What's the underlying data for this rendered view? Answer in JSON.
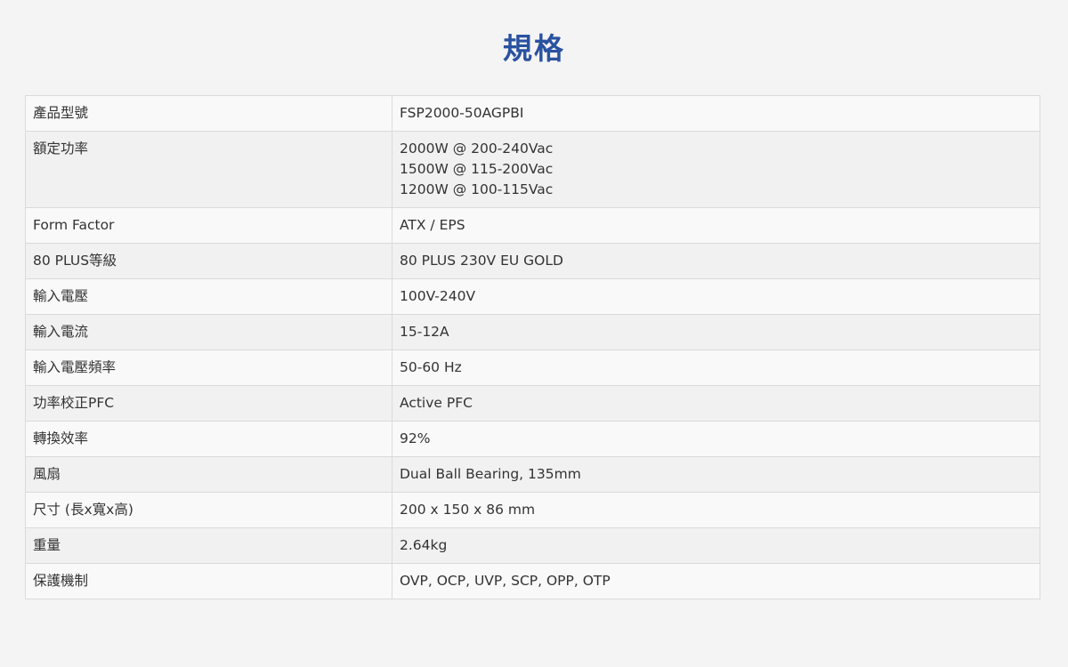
{
  "page": {
    "title": "規格"
  },
  "specs": {
    "rows": [
      {
        "label": "產品型號",
        "values": [
          "FSP2000-50AGPBI"
        ]
      },
      {
        "label": "額定功率",
        "values": [
          "2000W @ 200-240Vac",
          "1500W @ 115-200Vac",
          "1200W @ 100-115Vac"
        ]
      },
      {
        "label": "Form Factor",
        "values": [
          "ATX / EPS"
        ]
      },
      {
        "label": "80 PLUS等級",
        "values": [
          "80 PLUS 230V EU GOLD"
        ]
      },
      {
        "label": "輸入電壓",
        "values": [
          "100V-240V"
        ]
      },
      {
        "label": "輸入電流",
        "values": [
          "15-12A"
        ]
      },
      {
        "label": "輸入電壓頻率",
        "values": [
          "50-60 Hz"
        ]
      },
      {
        "label": "功率校正PFC",
        "values": [
          "Active PFC"
        ]
      },
      {
        "label": "轉換效率",
        "values": [
          "92%"
        ]
      },
      {
        "label": "風扇",
        "values": [
          "Dual Ball Bearing, 135mm"
        ]
      },
      {
        "label": "尺寸 (長x寬x高)",
        "values": [
          "200 x 150 x 86 mm"
        ]
      },
      {
        "label": "重量",
        "values": [
          "2.64kg"
        ]
      },
      {
        "label": "保護機制",
        "values": [
          "OVP, OCP, UVP, SCP, OPP, OTP"
        ]
      }
    ]
  }
}
